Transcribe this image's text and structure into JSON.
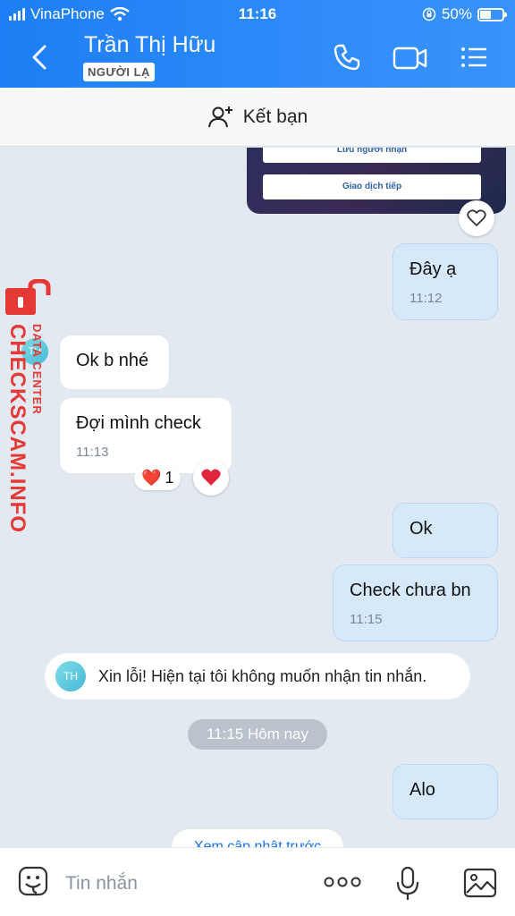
{
  "status_bar": {
    "carrier": "VinaPhone",
    "time": "11:16",
    "battery": "50%"
  },
  "header": {
    "contact_name": "Trần Thị Hữu",
    "badge": "NGƯỜI LẠ"
  },
  "add_friend": {
    "label": "Kết bạn"
  },
  "card": {
    "button1": "Lưu người nhận",
    "button2": "Giao dịch tiếp"
  },
  "messages": [
    {
      "side": "me",
      "text": "Đây ạ",
      "time": "11:12"
    },
    {
      "side": "them",
      "text": "Ok b nhé",
      "time": ""
    },
    {
      "side": "them",
      "text": "Đợi mình check",
      "time": "11:13",
      "reaction": "❤️",
      "reaction_count": "1"
    },
    {
      "side": "me",
      "text": "Ok",
      "time": ""
    },
    {
      "side": "me",
      "text": "Check chưa bn",
      "time": "11:15"
    }
  ],
  "system_message": {
    "avatar_initials": "TH",
    "text": "Xin lỗi! Hiện tại tôi không muốn nhận tin nhắn."
  },
  "date_chip": "11:15 Hôm nay",
  "last_message": {
    "side": "me",
    "text": "Alo"
  },
  "see_more": "Xem cập nhật trước",
  "composer": {
    "placeholder": "Tin nhắn"
  },
  "watermark": {
    "main": "CHECKSCAM.INFO",
    "sub": "DATA CENTER",
    "avatar_initials": "TH"
  },
  "colors": {
    "header": "#1d7ff5",
    "me_bubble": "#d5e9fb",
    "watermark": "#e53935"
  }
}
